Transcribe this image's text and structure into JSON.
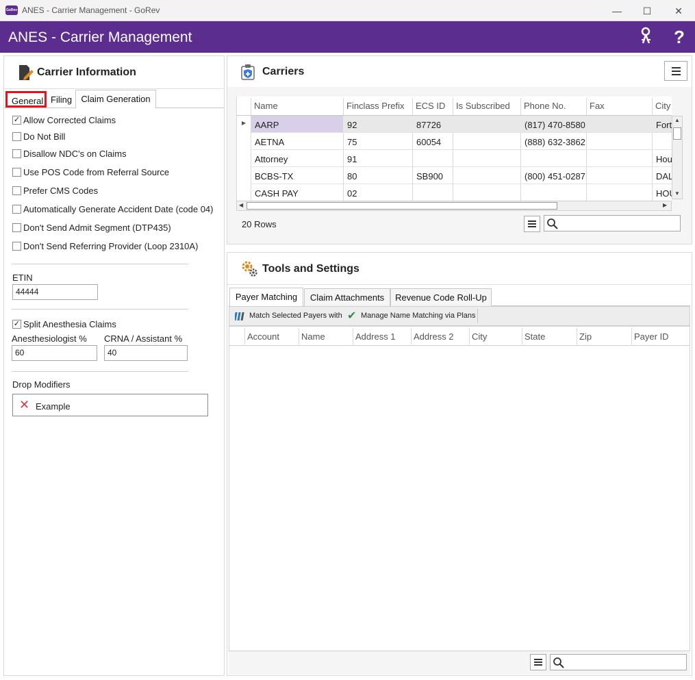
{
  "window": {
    "title": "ANES - Carrier Management - GoRev",
    "icon_text": "GoRev",
    "minimize_glyph": "—",
    "maximize_glyph": "☐",
    "close_glyph": "✕"
  },
  "header": {
    "title": "ANES - Carrier Management",
    "keys_icon": "keys-icon",
    "help_glyph": "?"
  },
  "carrier_info": {
    "title": "Carrier Information",
    "tabs": [
      "General",
      "Filing",
      "Claim Generation"
    ],
    "active_tab": "Claim Generation",
    "highlighted_tab": "General",
    "options": [
      {
        "label": "Allow Corrected Claims",
        "checked": true
      },
      {
        "label": "Do Not Bill",
        "checked": false
      },
      {
        "label": "Disallow NDC's on Claims",
        "checked": false
      },
      {
        "label": "Use POS Code from Referral Source",
        "checked": false
      },
      {
        "label": "Prefer CMS Codes",
        "checked": false
      },
      {
        "label": "Automatically Generate Accident Date (code 04)",
        "checked": false
      },
      {
        "label": "Don't Send Admit Segment (DTP435)",
        "checked": false
      },
      {
        "label": "Don't Send Referring Provider (Loop 2310A)",
        "checked": false
      }
    ],
    "etin_label": "ETIN",
    "etin_value": "44444",
    "split_label": "Split Anesthesia Claims",
    "split_checked": true,
    "anesthesiologist_label": "Anesthesiologist %",
    "anesthesiologist_value": "60",
    "crna_label": "CRNA / Assistant %",
    "crna_value": "40",
    "drop_modifiers_label": "Drop Modifiers",
    "drop_modifiers_item": "Example"
  },
  "carriers": {
    "title": "Carriers",
    "columns": [
      "Name",
      "Finclass Prefix",
      "ECS ID",
      "Is Subscribed",
      "Phone No.",
      "Fax",
      "City"
    ],
    "rows": [
      [
        "AARP",
        "92",
        "87726",
        "",
        "(817) 470-8580",
        "",
        "Fort"
      ],
      [
        "AETNA",
        "75",
        "60054",
        "",
        "(888) 632-3862",
        "",
        ""
      ],
      [
        "Attorney",
        "91",
        "",
        "",
        "",
        "",
        "Hou"
      ],
      [
        "BCBS-TX",
        "80",
        "SB900",
        "",
        "(800) 451-0287",
        "",
        "DAL"
      ],
      [
        "CASH PAY",
        "02",
        "",
        "",
        "",
        "",
        "HOU"
      ]
    ],
    "row_count": "20 Rows",
    "search_value": ""
  },
  "tools": {
    "title": "Tools and Settings",
    "tabs": [
      "Payer Matching",
      "Claim Attachments",
      "Revenue Code Roll-Up"
    ],
    "active_tab": "Payer Matching",
    "toolbar": {
      "match_label": "Match Selected Payers with",
      "manage_label": "Manage Name Matching via Plans"
    },
    "columns": [
      "Account",
      "Name",
      "Address 1",
      "Address 2",
      "City",
      "State",
      "Zip",
      "Payer ID"
    ],
    "search_value": ""
  },
  "colors": {
    "brand_purple": "#5b2d8e",
    "selection": "#d9cfe8",
    "highlight_red": "#e3131b",
    "remove_red": "#d9363e",
    "check_green": "#2e8b57",
    "gear_orange": "#e08a1e"
  }
}
